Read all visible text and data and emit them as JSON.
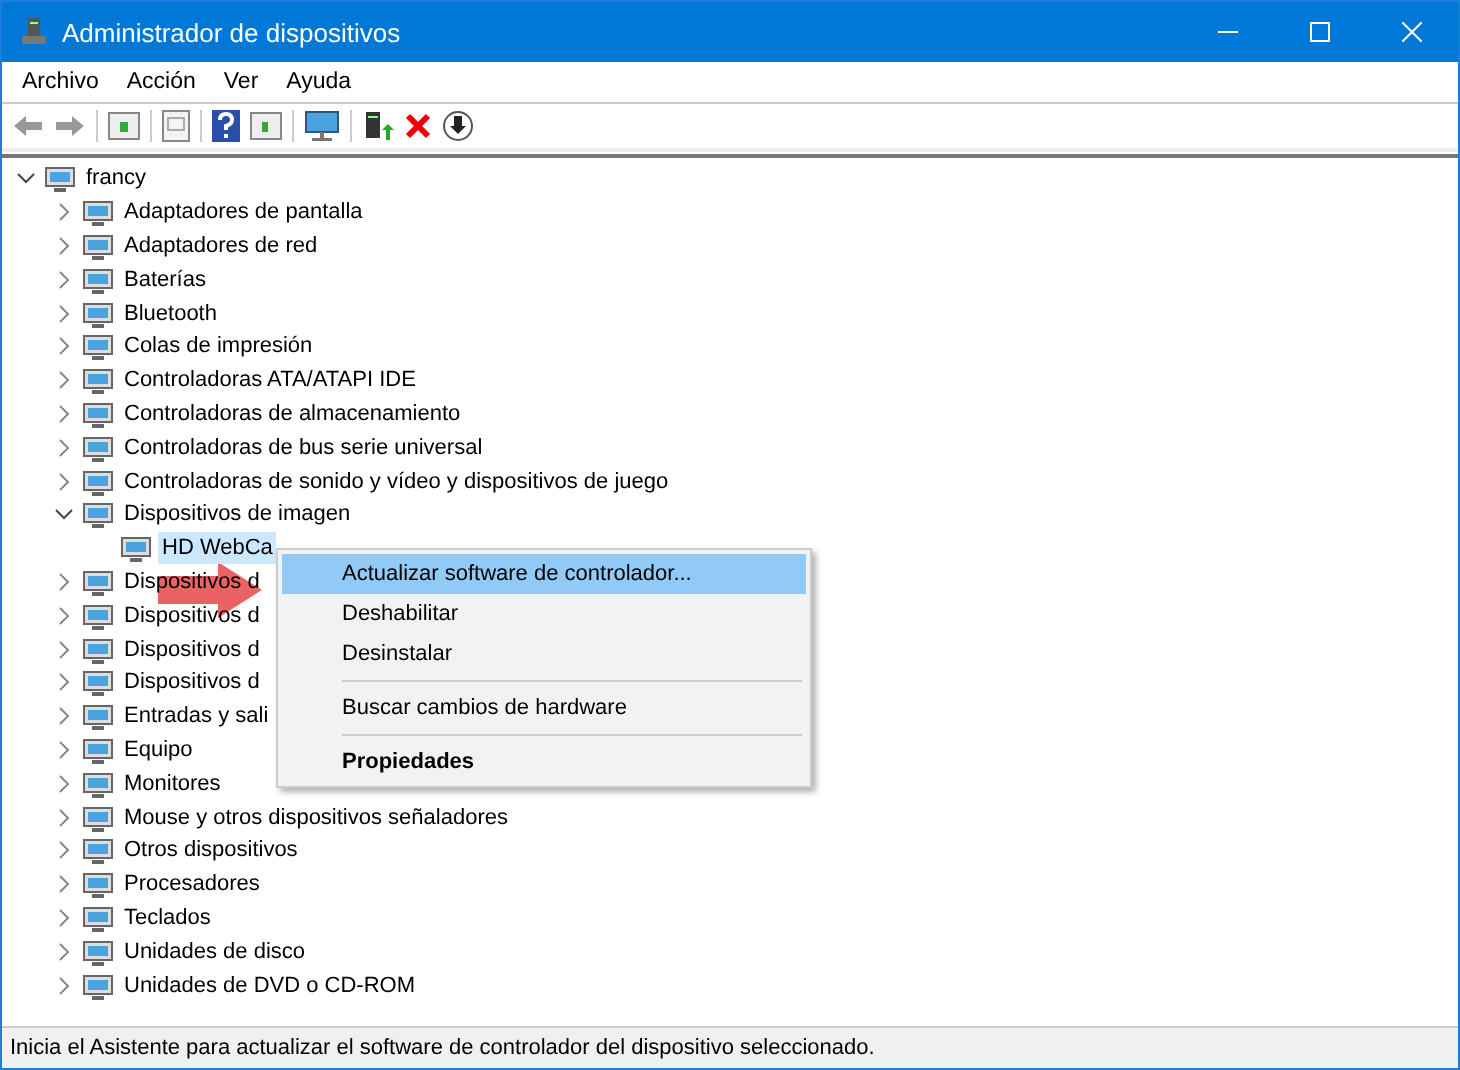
{
  "window": {
    "title": "Administrador de dispositivos"
  },
  "menu_bar": [
    "Archivo",
    "Acción",
    "Ver",
    "Ayuda"
  ],
  "tree": [
    {
      "label": "francy",
      "expanded": true,
      "selected": false,
      "children": [
        {
          "label": "Adaptadores de pantalla",
          "expanded": false,
          "selected": false
        },
        {
          "label": "Adaptadores de red",
          "expanded": false,
          "selected": false
        },
        {
          "label": "Baterías",
          "expanded": false,
          "selected": false
        },
        {
          "label": "Bluetooth",
          "expanded": false,
          "selected": false
        },
        {
          "label": "Colas de impresión",
          "expanded": false,
          "selected": false
        },
        {
          "label": "Controladoras ATA/ATAPI IDE",
          "expanded": false,
          "selected": false
        },
        {
          "label": "Controladoras de almacenamiento",
          "expanded": false,
          "selected": false
        },
        {
          "label": "Controladoras de bus serie universal",
          "expanded": false,
          "selected": false
        },
        {
          "label": "Controladoras de sonido y vídeo y dispositivos de juego",
          "expanded": false,
          "selected": false
        },
        {
          "label": "Dispositivos de imagen",
          "expanded": true,
          "selected": false,
          "children": [
            {
              "label": "HD WebCa",
              "selected": true
            }
          ]
        },
        {
          "label": "Dispositivos d",
          "expanded": false,
          "selected": false
        },
        {
          "label": "Dispositivos d",
          "expanded": false,
          "selected": false
        },
        {
          "label": "Dispositivos d",
          "expanded": false,
          "selected": false
        },
        {
          "label": "Dispositivos d",
          "expanded": false,
          "selected": false
        },
        {
          "label": "Entradas y sali",
          "expanded": false,
          "selected": false
        },
        {
          "label": "Equipo",
          "expanded": false,
          "selected": false
        },
        {
          "label": "Monitores",
          "expanded": false,
          "selected": false
        },
        {
          "label": "Mouse y otros dispositivos señaladores",
          "expanded": false,
          "selected": false
        },
        {
          "label": "Otros dispositivos",
          "expanded": false,
          "selected": false
        },
        {
          "label": "Procesadores",
          "expanded": false,
          "selected": false
        },
        {
          "label": "Teclados",
          "expanded": false,
          "selected": false
        },
        {
          "label": "Unidades de disco",
          "expanded": false,
          "selected": false
        },
        {
          "label": "Unidades de DVD o CD-ROM",
          "expanded": false,
          "selected": false
        }
      ]
    }
  ],
  "context_menu": [
    {
      "label": "Actualizar software de controlador...",
      "selected": true,
      "default": false,
      "separator_before": false
    },
    {
      "label": "Deshabilitar",
      "selected": false,
      "default": false,
      "separator_before": false
    },
    {
      "label": "Desinstalar",
      "selected": false,
      "default": false,
      "separator_before": false
    },
    {
      "label": "Buscar cambios de hardware",
      "selected": false,
      "default": false,
      "separator_before": true
    },
    {
      "label": "Propiedades",
      "selected": false,
      "default": true,
      "separator_before": true
    }
  ],
  "status_bar": "Inicia el Asistente para actualizar el software de controlador del dispositivo seleccionado."
}
